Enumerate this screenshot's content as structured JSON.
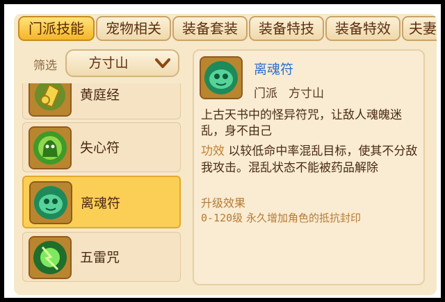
{
  "tabs": [
    {
      "label": "门派技能",
      "active": true
    },
    {
      "label": "宠物相关",
      "active": false
    },
    {
      "label": "装备套装",
      "active": false
    },
    {
      "label": "装备特技",
      "active": false
    },
    {
      "label": "装备特效",
      "active": false
    },
    {
      "label": "夫妻",
      "active": false
    }
  ],
  "filter": {
    "label": "筛选",
    "value": "方寸山",
    "icon": "chevron-down-icon"
  },
  "skills": [
    {
      "name": "黄庭经",
      "icon": "yellow-scroll-icon",
      "selected": false
    },
    {
      "name": "失心符",
      "icon": "green-figure-icon",
      "selected": false
    },
    {
      "name": "离魂符",
      "icon": "green-spirit-icon",
      "selected": true
    },
    {
      "name": "五雷咒",
      "icon": "green-lightning-icon",
      "selected": false
    }
  ],
  "detail": {
    "name": "离魂符",
    "school_label": "门派",
    "school_value": "方寸山",
    "description": "上古天书中的怪异符咒，让敌人魂魄迷乱，身不由己",
    "effect_tag": "功效",
    "effect_text": "以较低命中率混乱目标，使其不分敌我攻击。混乱状态不能被药品解除",
    "upgrade_title": "升级效果",
    "upgrade_range": "0-120级",
    "upgrade_text": "永久增加角色的抵抗封印"
  },
  "colors": {
    "active_tab": "#f5b62a",
    "skill_name": "#2e6fd0",
    "effect_tag": "#c0802e"
  }
}
